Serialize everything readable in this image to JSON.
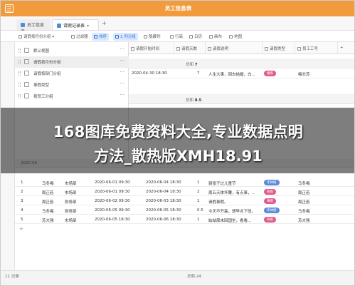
{
  "app": {
    "title": "员工信息表",
    "accent": "#f19b3c"
  },
  "tabs": [
    {
      "label": "员工信息表"
    },
    {
      "label": "请假记录表"
    }
  ],
  "toolbar": {
    "items": [
      {
        "label": "请假按月份分组",
        "icon": "grid-icon"
      },
      {
        "label": "过滤器",
        "icon": "filter-icon"
      },
      {
        "label": "排序",
        "icon": "sort-icon",
        "active": true
      },
      {
        "label": "1 列分组",
        "icon": "group-icon",
        "active": true
      },
      {
        "label": "隐藏列",
        "icon": "eye-icon"
      },
      {
        "label": "行高",
        "icon": "rowheight-icon"
      },
      {
        "label": "日历",
        "icon": "calendar-icon"
      },
      {
        "label": "画布",
        "icon": "canvas-icon"
      },
      {
        "label": "地图",
        "icon": "map-icon"
      }
    ]
  },
  "views": [
    {
      "label": "默认视图"
    },
    {
      "label": "请假按月份分组",
      "selected": true
    },
    {
      "label": "请假按部门分组"
    },
    {
      "label": "事假类型"
    },
    {
      "label": "按员工分组"
    }
  ],
  "columns": [
    "请假开始时间",
    "请假天数",
    "请假说明",
    "请假类型",
    "员工工号"
  ],
  "groups": [
    {
      "label": "总和",
      "value": "7"
    },
    {
      "label": "总和",
      "value": "8.5"
    },
    {
      "label": "总和",
      "value": "24"
    }
  ],
  "upper_rows": [
    {
      "start": "2020-04-30 18:30",
      "days": "7",
      "note": "人生大事，回去结婚，白...",
      "type": "婚假",
      "emp": "梅长苏"
    }
  ],
  "lower_section": {
    "group_date": "2020-06",
    "rows": [
      {
        "name": "马冬梅",
        "dept": "市场部",
        "start": "2020-06-01 09:30",
        "end": "2020-06-04 18:30",
        "days": "1",
        "note": "骑张子过儿童节",
        "type": "年休假",
        "emp": "马冬梅"
      },
      {
        "name": "周正若",
        "dept": "市场部",
        "start": "2020-06-01 09:30",
        "end": "2020-06-04 18:30",
        "days": "2",
        "note": "周五天体坏腰，有点事，...",
        "type": "病假",
        "emp": "周正若"
      },
      {
        "name": "周正若",
        "dept": "财务部",
        "start": "2020-06-02 09:30",
        "end": "2020-06-03 18:30",
        "days": "1",
        "note": "请假事假。",
        "type": "事假",
        "emp": "周正若"
      },
      {
        "name": "马冬梅",
        "dept": "财务部",
        "start": "2020-06-05 09:30",
        "end": "2020-06-05 18:30",
        "days": "0.5",
        "note": "今天不开森，想早点下班。",
        "type": "年休假",
        "emp": "马冬梅"
      },
      {
        "name": "苏大强",
        "dept": "市场部",
        "start": "2020-06-05 18:30",
        "end": "2020-06-06 18:30",
        "days": "1",
        "note": "姑姑周末回国坐，看看...",
        "type": "病假",
        "emp": "苏大强"
      }
    ]
  },
  "footer": {
    "count_left": "11 记录",
    "sum_label": "总和 24"
  },
  "overlay": {
    "line1": "168图库免费资料大全,专业数据点明",
    "line2": "方法_散热版XMH18.91"
  }
}
